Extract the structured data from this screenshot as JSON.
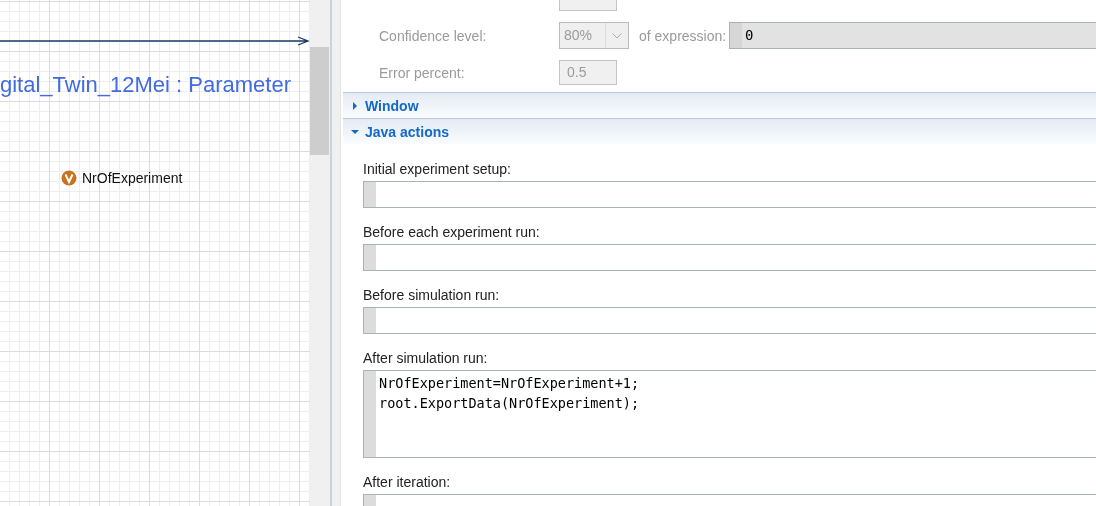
{
  "diagram": {
    "title": "gital_Twin_12Mei : Parameter",
    "variables": [
      {
        "name": "NrOfExperiment"
      }
    ]
  },
  "settings_rows": [
    {
      "kind": "text",
      "disabled": true
    },
    {
      "kind": "combo",
      "label": "Confidence level:",
      "value": "80%",
      "disabled": true,
      "extra_label": "of expression:",
      "expression": "0"
    },
    {
      "kind": "text",
      "label": "Error percent:",
      "value": "0.5",
      "disabled": true
    }
  ],
  "sections": [
    {
      "title": "Window",
      "expanded": false
    },
    {
      "title": "Java actions",
      "expanded": true,
      "fields": [
        {
          "label": "Initial experiment setup:"
        },
        {
          "label": "Before each experiment run:"
        },
        {
          "label": "Before simulation run:"
        },
        {
          "label": "After simulation run:",
          "code": "NrOfExperiment=NrOfExperiment+1;\nroot.ExportData(NrOfExperiment);"
        },
        {
          "label": "After iteration:"
        }
      ]
    }
  ]
}
